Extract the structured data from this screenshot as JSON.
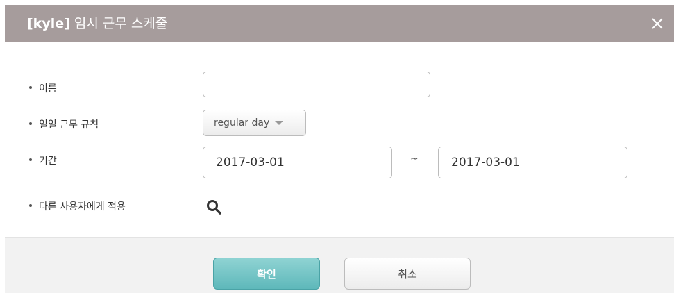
{
  "dialog": {
    "title_bold": "[kyle]",
    "title_rest": "임시 근무 스케줄"
  },
  "form": {
    "name_label": "이름",
    "name_value": "",
    "rule_label": "일일 근무 규칙",
    "rule_value": "regular day",
    "period_label": "기간",
    "start_date": "2017-03-01",
    "separator": "~",
    "end_date": "2017-03-01",
    "apply_label": "다른 사용자에게 적용"
  },
  "footer": {
    "ok_label": "확인",
    "cancel_label": "취소"
  },
  "icons": {
    "close": "close-icon",
    "search": "search-icon",
    "dropdown": "chevron-down-icon"
  },
  "colors": {
    "header": "#a69c9c",
    "ok_button": "#6cc2c4"
  }
}
